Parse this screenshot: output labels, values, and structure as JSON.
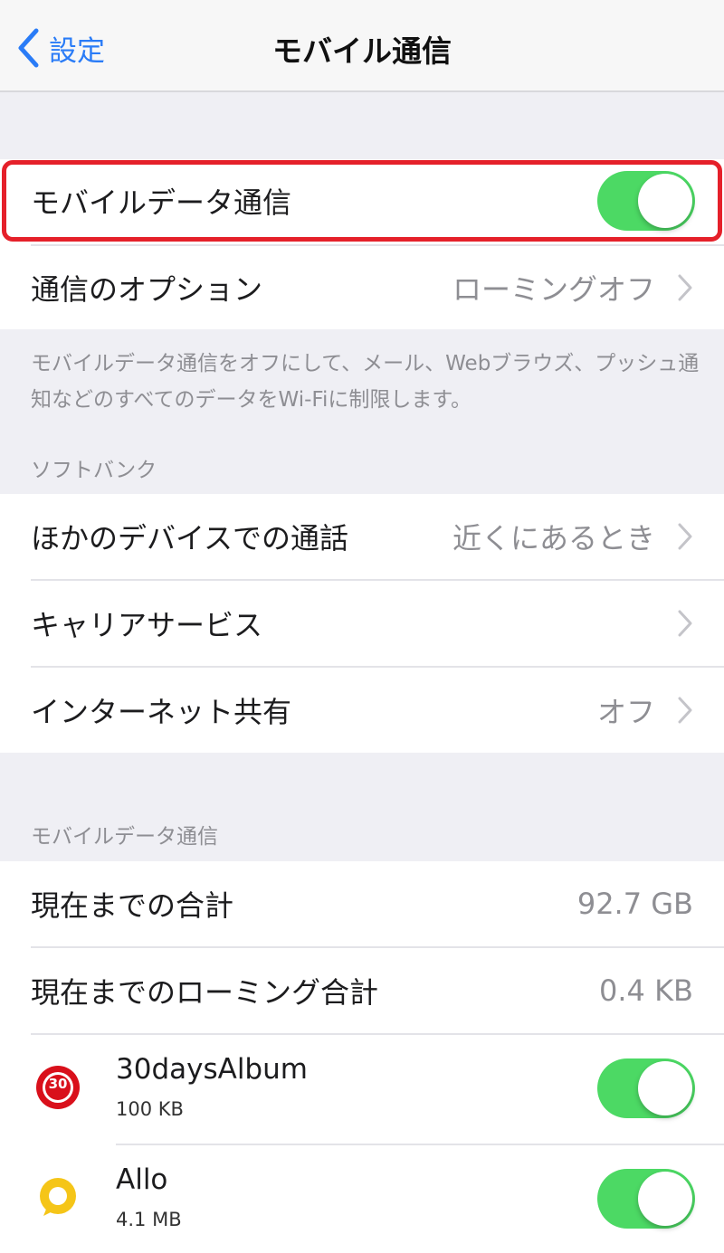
{
  "nav": {
    "back_label": "設定",
    "title": "モバイル通信"
  },
  "main_group": {
    "mobile_data_label": "モバイルデータ通信",
    "mobile_data_on": true,
    "options_label": "通信のオプション",
    "options_value": "ローミングオフ"
  },
  "footnote": "モバイルデータ通信をオフにして、メール、Webブラウズ、プッシュ通知などのすべてのデータをWi-Fiに制限します。",
  "carrier_section": {
    "header": "ソフトバンク",
    "rows": [
      {
        "label": "ほかのデバイスでの通話",
        "value": "近くにあるとき"
      },
      {
        "label": "キャリアサービス",
        "value": ""
      },
      {
        "label": "インターネット共有",
        "value": "オフ"
      }
    ]
  },
  "usage_section": {
    "header": "モバイルデータ通信",
    "total_label": "現在までの合計",
    "total_value": "92.7 GB",
    "roaming_label": "現在までのローミング合計",
    "roaming_value": "0.4 KB",
    "apps": [
      {
        "name": "30daysAlbum",
        "size": "100 KB",
        "icon": "30daysalbum-icon",
        "icon_text": "30",
        "enabled": true
      },
      {
        "name": "Allo",
        "size": "4.1 MB",
        "icon": "allo-icon",
        "enabled": true
      }
    ]
  },
  "colors": {
    "accent": "#2a7cf7",
    "switch_on": "#4cd964",
    "highlight": "#e5202a",
    "app_red": "#d9101b",
    "app_yellow": "#f5c518"
  }
}
